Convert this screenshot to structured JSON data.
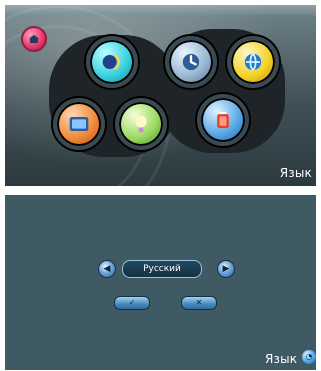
{
  "top_screen": {
    "menu_items": [
      {
        "icon": "music-player-icon"
      },
      {
        "icon": "photo-viewer-icon"
      },
      {
        "icon": "brightness-bulb-icon"
      },
      {
        "icon": "clock-icon"
      },
      {
        "icon": "globe-language-icon"
      },
      {
        "icon": "battery-icon"
      }
    ],
    "home_icon": "home-icon",
    "caption": "Язык"
  },
  "bottom_screen": {
    "language_value": "Русский",
    "prev_icon": "arrow-left-icon",
    "next_icon": "arrow-right-icon",
    "confirm_icon": "check-icon",
    "cancel_icon": "close-icon",
    "caption": "Язык",
    "caption_icon": "globe-icon"
  }
}
